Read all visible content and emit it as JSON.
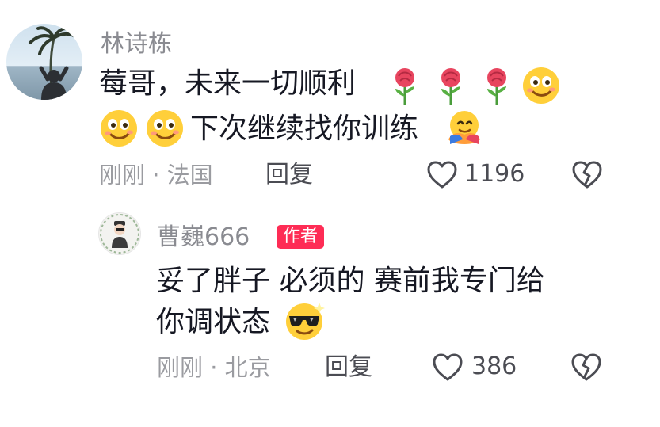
{
  "comment": {
    "author": "林诗栋",
    "line1_text": "莓哥，未来一切顺利",
    "line2_text": "下次继续找你训练",
    "time": "刚刚",
    "location": "法国",
    "reply_label": "回复",
    "like_count": "1196",
    "icons": [
      "rose-emoji",
      "rose-emoji",
      "rose-emoji",
      "smiling-face-emoji",
      "smiling-face-emoji",
      "smiling-face-emoji",
      "hug-emoji",
      "heart-outline-icon",
      "broken-heart-icon"
    ]
  },
  "reply": {
    "author": "曹巍666",
    "badge": "作者",
    "line1_text": "妥了胖子 必须的 赛前我专门给",
    "line2_text": "你调状态",
    "time": "刚刚",
    "location": "北京",
    "reply_label": "回复",
    "like_count": "386",
    "icons": [
      "cool-sunglasses-emoji",
      "heart-outline-icon",
      "broken-heart-icon"
    ]
  },
  "separator": "·",
  "colors": {
    "badge_bg": "#fe2c55",
    "meta_gray": "#9a9ba0",
    "text_dark": "#161823"
  }
}
